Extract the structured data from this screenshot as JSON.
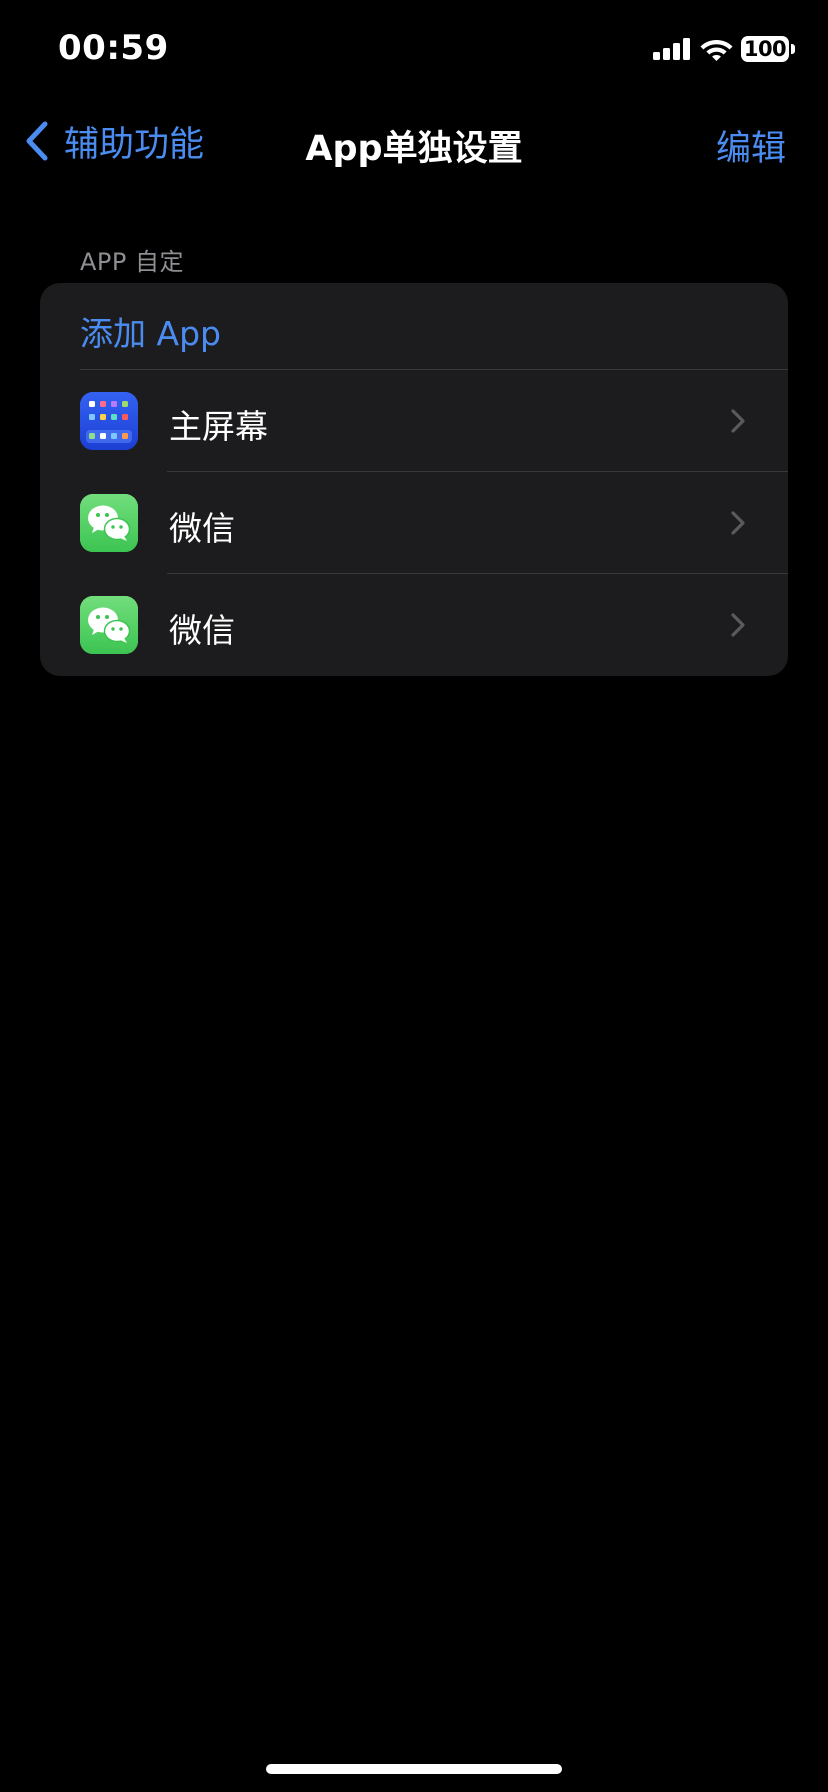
{
  "status_bar": {
    "time": "00:59",
    "battery": "100",
    "signal_icon": "cellular-signal-icon",
    "wifi_icon": "wifi-icon"
  },
  "nav": {
    "back_label": "辅助功能",
    "title": "App单独设置",
    "edit_label": "编辑",
    "back_icon": "chevron-left-icon"
  },
  "section": {
    "header": "APP 自定"
  },
  "list": {
    "add_label": "添加 App",
    "items": [
      {
        "label": "主屏幕",
        "icon": "home-screen-icon"
      },
      {
        "label": "微信",
        "icon": "wechat-icon"
      },
      {
        "label": "微信",
        "icon": "wechat-icon"
      }
    ]
  },
  "colors": {
    "accent": "#4a8cf0",
    "background": "#000000",
    "card": "#1c1c1e",
    "separator": "#38383a",
    "secondary_text": "#8e8e93",
    "chevron": "#5a5a5e"
  }
}
